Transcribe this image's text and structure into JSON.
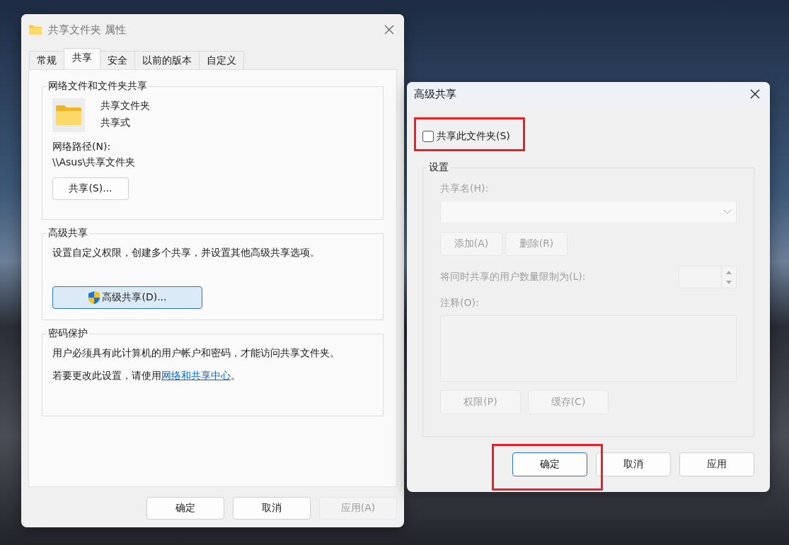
{
  "properties_window": {
    "title": "共享文件夹 属性",
    "tabs": [
      {
        "label": "常规",
        "selected": false
      },
      {
        "label": "共享",
        "selected": true
      },
      {
        "label": "安全",
        "selected": false
      },
      {
        "label": "以前的版本",
        "selected": false
      },
      {
        "label": "自定义",
        "selected": false
      }
    ],
    "network_group": {
      "title": "网络文件和文件夹共享",
      "folder_name": "共享文件夹",
      "folder_status": "共享式",
      "path_label": "网络路径(N):",
      "path": "\\\\Asus\\共享文件夹",
      "share_button": "共享(S)..."
    },
    "advanced_group": {
      "title": "高级共享",
      "description": "设置自定义权限，创建多个共享，并设置其他高级共享选项。",
      "button": "高级共享(D)..."
    },
    "password_group": {
      "title": "密码保护",
      "description": "用户必须具有此计算机的用户帐户和密码，才能访问共享文件夹。",
      "hint_before": "若要更改此设置，请使用",
      "link": "网络和共享中心",
      "hint_after": "。"
    },
    "buttons": [
      {
        "label": "确定",
        "disabled": false
      },
      {
        "label": "取消",
        "disabled": false
      },
      {
        "label": "应用(A)",
        "disabled": true
      }
    ]
  },
  "advanced_window": {
    "title": "高级共享",
    "share_checkbox": {
      "label": "共享此文件夹(S)",
      "checked": false
    },
    "settings_group": {
      "title": "设置",
      "disabled": true,
      "share_name_label": "共享名(H):",
      "add_button": "添加(A)",
      "remove_button": "删除(R)",
      "limit_label": "将同时共享的用户数量限制为(L):",
      "comment_label": "注释(O):",
      "permissions_button": "权限(P)",
      "cache_button": "缓存(C)"
    },
    "buttons": [
      {
        "label": "确定",
        "default": true
      },
      {
        "label": "取消",
        "default": false
      },
      {
        "label": "应用",
        "default": false
      }
    ]
  }
}
